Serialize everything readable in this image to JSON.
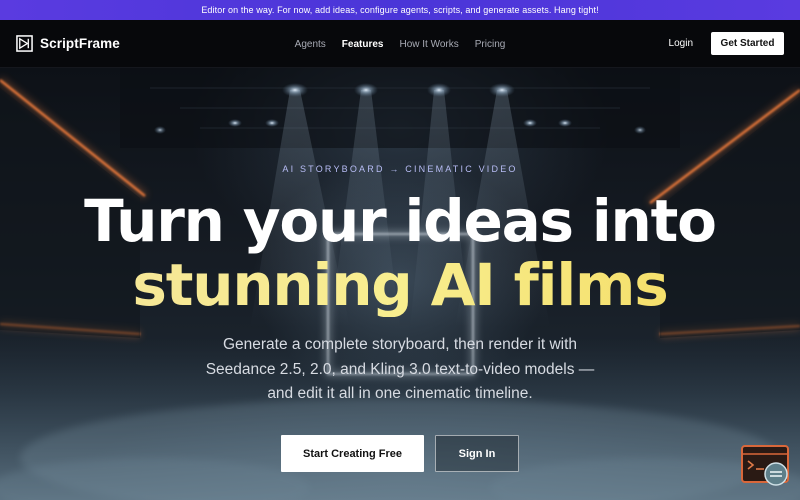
{
  "banner": {
    "text": "Editor on the way. For now, add ideas, configure agents, scripts, and generate assets. Hang tight!"
  },
  "nav": {
    "brand": "ScriptFrame",
    "links": [
      {
        "label": "Agents",
        "active": false
      },
      {
        "label": "Features",
        "active": true
      },
      {
        "label": "How It Works",
        "active": false
      },
      {
        "label": "Pricing",
        "active": false
      }
    ],
    "login": "Login",
    "cta": "Get Started"
  },
  "hero": {
    "eyebrow": "AI STORYBOARD → CINEMATIC VIDEO",
    "headline_line1": "Turn your ideas into",
    "headline_line2": "stunning AI films",
    "subtitle_line1": "Generate a complete storyboard, then render it with",
    "subtitle_line2": "Seedance 2.5, 2.0, and Kling 3.0 text-to-video models —",
    "subtitle_line3": "and edit it all in one cinematic timeline.",
    "primary_cta": "Start Creating Free",
    "secondary_cta": "Sign In"
  },
  "widget": {
    "icon": "terminal-chat-icon"
  },
  "colors": {
    "banner": "#4f37db",
    "headline_accent": "#f5e28a",
    "neon": "#e0632b",
    "widget": "#d9673a"
  }
}
